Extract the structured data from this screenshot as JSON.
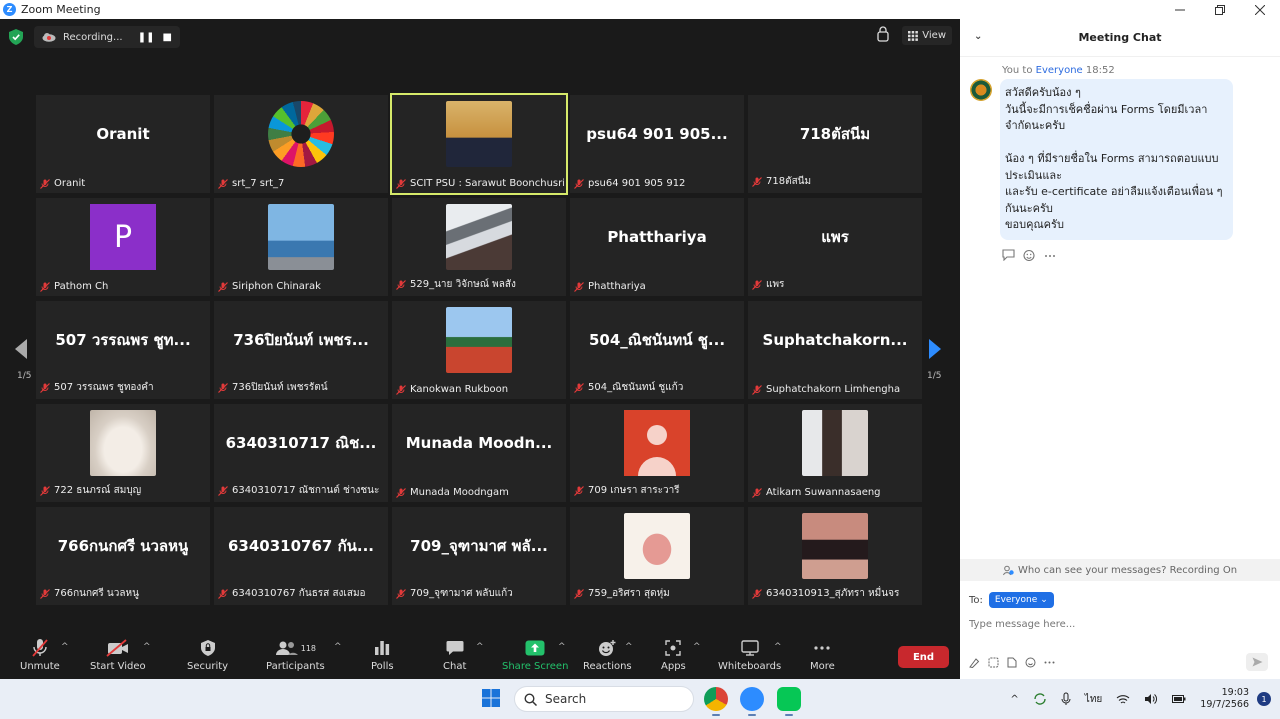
{
  "window": {
    "title": "Zoom Meeting",
    "logo_letter": "Z"
  },
  "topbar": {
    "recording_label": "Recording...",
    "view_label": "View"
  },
  "gallery": {
    "page_indicator_left": "1/5",
    "page_indicator_right": "1/5",
    "tiles": [
      {
        "display": "Oranit",
        "label": "Oranit",
        "type": "name"
      },
      {
        "display": "",
        "label": "srt_7 srt_7",
        "type": "sdg-logo"
      },
      {
        "display": "",
        "label": "SCIT PSU : Sarawut Boonchusri",
        "type": "photo-suit",
        "active": true
      },
      {
        "display": "psu64 901 905...",
        "label": "psu64 901 905 912",
        "type": "name"
      },
      {
        "display": "718ตัสนีม",
        "label": "718ตัสนีม",
        "type": "name"
      },
      {
        "display": "P",
        "label": "Pathom Ch",
        "type": "letter"
      },
      {
        "display": "",
        "label": "Siriphon Chinarak",
        "type": "photo-sea"
      },
      {
        "display": "",
        "label": "529_นาย วิจักษณ์ พลสัง",
        "type": "photo-bird"
      },
      {
        "display": "Phatthariya",
        "label": "Phatthariya",
        "type": "name"
      },
      {
        "display": "แพร",
        "label": "แพร",
        "type": "name"
      },
      {
        "display": "507 วรรณพร ชูท...",
        "label": "507 วรรณพร ชูทองคำ",
        "type": "name"
      },
      {
        "display": "736ปิยนันท์ เพชร...",
        "label": "736ปิยนันท์ เพชรรัตน์",
        "type": "name"
      },
      {
        "display": "",
        "label": "Kanokwan Rukboon",
        "type": "photo-track"
      },
      {
        "display": "504_ณิชนันทน์ ชู...",
        "label": "504_ณิชนันทน์ ชูแก้ว",
        "type": "name"
      },
      {
        "display": "Suphatchakorn...",
        "label": "Suphatchakorn Limhengha",
        "type": "name"
      },
      {
        "display": "",
        "label": "722 ธนภรณ์ สมบุญ",
        "type": "photo-cat"
      },
      {
        "display": "6340310717 ณิช...",
        "label": "6340310717 ณัชกานต์ ช่างชนะ",
        "type": "name"
      },
      {
        "display": "Munada Moodn...",
        "label": "Munada Moodngam",
        "type": "name"
      },
      {
        "display": "",
        "label": "709 เกษรา สาระวารี",
        "type": "person-placeholder"
      },
      {
        "display": "",
        "label": "Atikarn Suwannasaeng",
        "type": "photo-girl"
      },
      {
        "display": "766กนกศรี นวลหนู",
        "label": "766กนกศรี นวลหนู",
        "type": "name"
      },
      {
        "display": "6340310767 กัน...",
        "label": "6340310767 กันธรส สงเสมอ",
        "type": "name"
      },
      {
        "display": "709_จุฑามาศ พลั...",
        "label": "709_จุฑามาศ พลับแก้ว",
        "type": "name"
      },
      {
        "display": "",
        "label": "759_อริศรา สุดหุ่ม",
        "type": "photo-drawing"
      },
      {
        "display": "",
        "label": "6340310913_สุภัทรา หมื่นจร",
        "type": "photo-woman"
      }
    ]
  },
  "toolbar": {
    "unmute": "Unmute",
    "start_video": "Start Video",
    "security": "Security",
    "participants": "Participants",
    "participants_count": "118",
    "polls": "Polls",
    "chat": "Chat",
    "share_screen": "Share Screen",
    "reactions": "Reactions",
    "apps": "Apps",
    "whiteboards": "Whiteboards",
    "more": "More",
    "end": "End"
  },
  "chat": {
    "title": "Meeting Chat",
    "from": "You to",
    "to": "Everyone",
    "time": "18:52",
    "message": "สวัสดีครับน้อง ๆ\nวันนี้จะมีการเช็คชื่อผ่าน Forms โดยมีเวลาจำกัดนะครับ\n\nน้อง ๆ ที่มีรายชื่อใน Forms สามารถตอบแบบประเมินและ\nและรับ e-certificate อย่าลืมแจ้งเตือนเพื่อน ๆ กันนะครับ\nขอบคุณครับ",
    "visibility_note": "Who can see your messages? Recording On",
    "to_label": "To:",
    "recipient": "Everyone",
    "input_placeholder": "Type message here..."
  },
  "taskbar": {
    "search_placeholder": "Search",
    "language": "ไทย",
    "time": "19:03",
    "date": "19/7/2566",
    "notification_count": "1"
  },
  "colors": {
    "accent": "#2d8cff",
    "share_green": "#23c16b",
    "end_red": "#c8282d",
    "active_speaker": "#d6ea6a",
    "chat_bubble": "#e7f1fd"
  }
}
